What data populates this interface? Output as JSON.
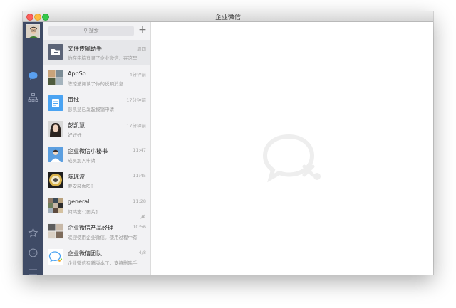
{
  "window": {
    "title": "企业微信"
  },
  "search": {
    "placeholder": "搜索",
    "add_label": "+"
  },
  "sidebar": {
    "nav": [
      {
        "icon": "chat-bubble-icon",
        "active": true
      },
      {
        "icon": "org-chart-icon",
        "active": false
      },
      {
        "icon": "star-icon",
        "active": false
      },
      {
        "icon": "clock-icon",
        "active": false
      },
      {
        "icon": "menu-icon",
        "active": false
      }
    ]
  },
  "conversations": [
    {
      "name": "文件传输助手",
      "message": "你在电脑登录了企业微信，在这里...",
      "time": "周四",
      "selected": true,
      "avatar": "folder-icon"
    },
    {
      "name": "AppSo",
      "message": "陈琼波阅读了你的说明消息",
      "time": "4分钟前",
      "avatar": "group-photo"
    },
    {
      "name": "审批",
      "message": "彭凯慧已发起报销申请",
      "time": "17分钟前",
      "avatar": "approval-icon"
    },
    {
      "name": "彭凯慧",
      "message": "好好好",
      "time": "17分钟前",
      "avatar": "person-photo"
    },
    {
      "name": "企业微信小秘书",
      "message": "成员加入申请",
      "time": "11:47",
      "avatar": "assistant-icon"
    },
    {
      "name": "陈琼波",
      "message": "要安装你吗?",
      "time": "11:45",
      "avatar": "person-photo"
    },
    {
      "name": "general",
      "message": "何鸿志: [图片]",
      "time": "11:28",
      "muted": true,
      "avatar": "group-photo"
    },
    {
      "name": "企业微信产品经理",
      "message": "欢迎使用企业微信。使用过程中有...",
      "time": "10:56",
      "avatar": "group-photo"
    },
    {
      "name": "企业微信团队",
      "message": "企业微信有新版本了，支持删除手...",
      "time": "4/8",
      "avatar": "wework-logo-icon"
    }
  ],
  "colors": {
    "sidebar_bg": "#3f4b66",
    "nav_active": "#5aa0f0",
    "nav_inactive": "#8c96ad",
    "list_bg": "#f2f2f4",
    "selected_row": "#e6e7ea",
    "empty_logo": "#eeeeee"
  }
}
